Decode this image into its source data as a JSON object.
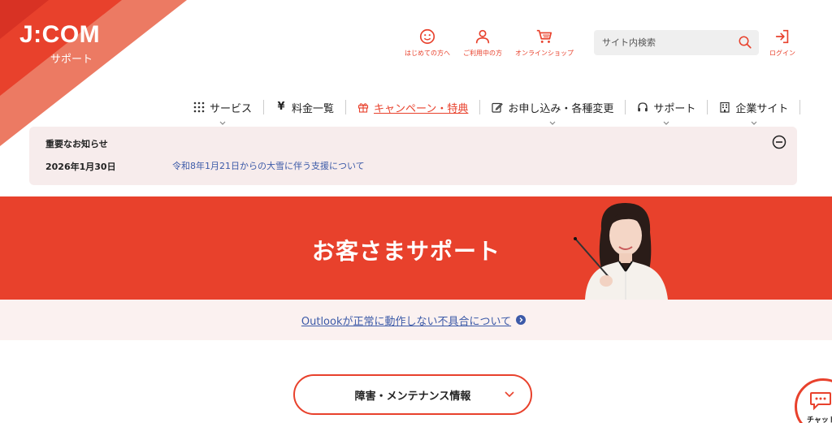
{
  "brand": {
    "logo": "J:COM",
    "sub": "サポート",
    "accent": "#e8412c"
  },
  "utility": [
    {
      "label": "はじめての方へ",
      "icon": "smile-icon"
    },
    {
      "label": "ご利用中の方",
      "icon": "person-icon"
    },
    {
      "label": "オンラインショップ",
      "icon": "cart-icon"
    }
  ],
  "search": {
    "placeholder": "サイト内検索",
    "icon": "search-icon"
  },
  "login": {
    "label": "ログイン",
    "icon": "login-icon"
  },
  "nav": [
    {
      "label": "サービス",
      "icon": "grid-icon"
    },
    {
      "label": "料金一覧",
      "icon": "yen-icon"
    },
    {
      "label": "キャンペーン・特典",
      "icon": "gift-icon"
    },
    {
      "label": "お申し込み・各種変更",
      "icon": "edit-icon"
    },
    {
      "label": "サポート",
      "icon": "headset-icon"
    },
    {
      "label": "企業サイト",
      "icon": "building-icon"
    }
  ],
  "notice": {
    "title": "重要なお知らせ",
    "date": "2026年1月30日",
    "link": "令和8年1月21日からの大雪に伴う支援について"
  },
  "hero": {
    "title": "お客さまサポート"
  },
  "info": {
    "link": "Outlookが正常に動作しない不具合について"
  },
  "maintenance": {
    "label": "障害・メンテナンス情報"
  },
  "chat": {
    "label": "チャット"
  }
}
